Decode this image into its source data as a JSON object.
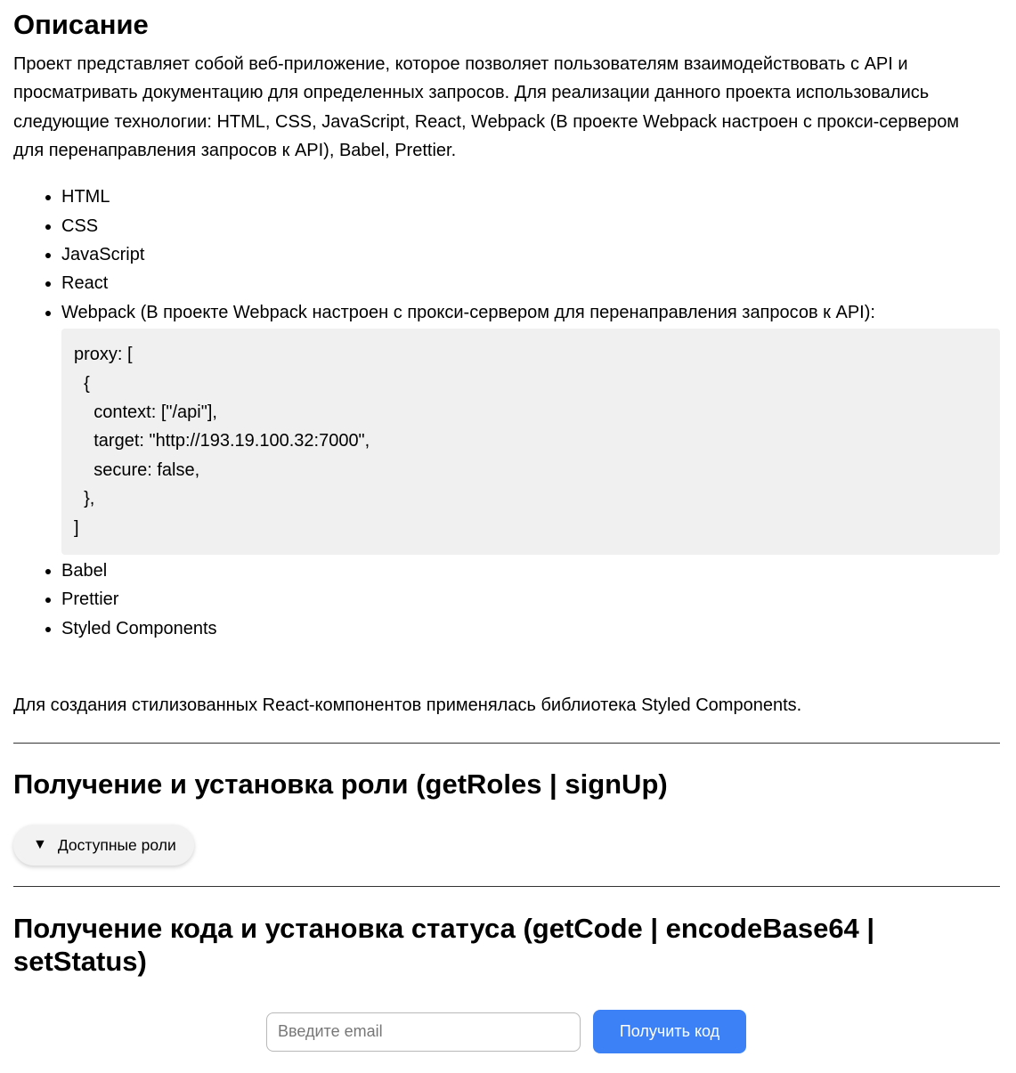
{
  "description": {
    "title": "Описание",
    "intro": "Проект представляет собой веб-приложение, которое позволяет пользователям взаимодействовать с API и просматривать документацию для определенных запросов. Для реализации данного проекта использовались следующие технологии: HTML, CSS, JavaScript, React, Webpack (В проекте Webpack настроен с прокси-сервером для перенаправления запросов к API), Babel, Prettier.",
    "tech_list": {
      "html": "HTML",
      "css": "CSS",
      "javascript": "JavaScript",
      "react": "React",
      "webpack": "Webpack (В проекте Webpack настроен с прокси-сервером для перенаправления запросов к API):",
      "babel": "Babel",
      "prettier": "Prettier",
      "styled_components": "Styled Components"
    },
    "webpack_code": "proxy: [\n  {\n    context: [\"/api\"],\n    target: \"http://193.19.100.32:7000\",\n    secure: false,\n  },\n]",
    "styled_note": "Для создания стилизованных React-компонентов применялась библиотека Styled Components."
  },
  "roles_section": {
    "title": "Получение и установка роли (getRoles | signUp)",
    "toggle_icon": "▼",
    "toggle_label": "Доступные роли"
  },
  "code_section": {
    "title": "Получение кода и установка статуса (getCode | encodeBase64 | setStatus)",
    "email_placeholder": "Введите email",
    "email_value": "",
    "button_label": "Получить код"
  },
  "colors": {
    "button_bg": "#3c82f6",
    "code_bg": "#f0f0f0",
    "toggle_bg": "#f2f2f2",
    "divider": "#333333"
  }
}
